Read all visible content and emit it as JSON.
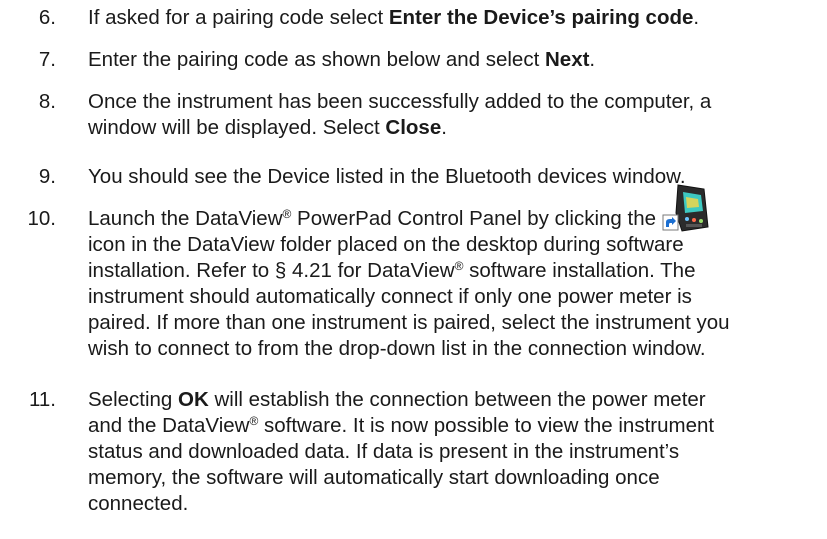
{
  "steps": [
    {
      "number": "6.",
      "parts": [
        "If asked for a pairing code select ",
        "Enter the Device’s pairing code",
        "."
      ]
    },
    {
      "number": "7.",
      "parts": [
        "Enter the pairing code as shown below and select ",
        "Next",
        "."
      ]
    },
    {
      "number": "8.",
      "line1": "Once the instrument has been successfully added to the computer, a",
      "parts": [
        "window will be displayed. Select ",
        "Close",
        "."
      ]
    },
    {
      "number": "9.",
      "text": "You should see the Device listed in the Bluetooth devices window."
    },
    {
      "number": "10.",
      "line1a": "Launch the DataView",
      "line1b": " PowerPad Control Panel by clicking the",
      "line2": "icon in the DataView folder placed on the desktop during software",
      "line3a": "installation. Refer to § 4.21 for DataView",
      "line3b": " software installation. The",
      "line4": "instrument should automatically connect if only one power meter is",
      "line5": "paired. If more than one instrument is paired, select the instrument you",
      "line6": "wish to connect to from the drop-down list in the connection window."
    },
    {
      "number": "11.",
      "line1a": "Selecting ",
      "line1b": "OK",
      "line1c": " will establish the connection between the power meter",
      "line2a": "and the DataView",
      "line2b": " software. It is now possible to view the instrument",
      "line3": "status and downloaded data. If data is present in the instrument’s",
      "line4": "memory, the software will automatically start downloading once",
      "line5": "connected."
    }
  ],
  "registered_mark": "®",
  "icon": "powerpad-shortcut-icon"
}
